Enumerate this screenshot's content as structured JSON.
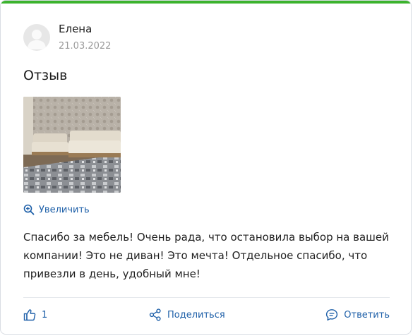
{
  "review": {
    "author": "Елена",
    "date": "21.03.2022",
    "title": "Отзыв",
    "zoom_label": "Увеличить",
    "text": "Спасибо за мебель! Очень рада, что остановила выбор на вашей компании! Это не диван! Это мечта! Отдельное спасибо, что привезли в день, удобный мне!"
  },
  "actions": {
    "likes": "1",
    "share_label": "Поделиться",
    "reply_label": "Ответить"
  },
  "colors": {
    "accent": "#3cb32e",
    "link": "#1d5fa8",
    "muted": "#9a9a9a"
  },
  "icons": {
    "avatar": "user-silhouette-icon",
    "zoom": "zoom-in-icon",
    "like": "thumbs-up-icon",
    "share": "share-icon",
    "reply": "comment-icon"
  }
}
